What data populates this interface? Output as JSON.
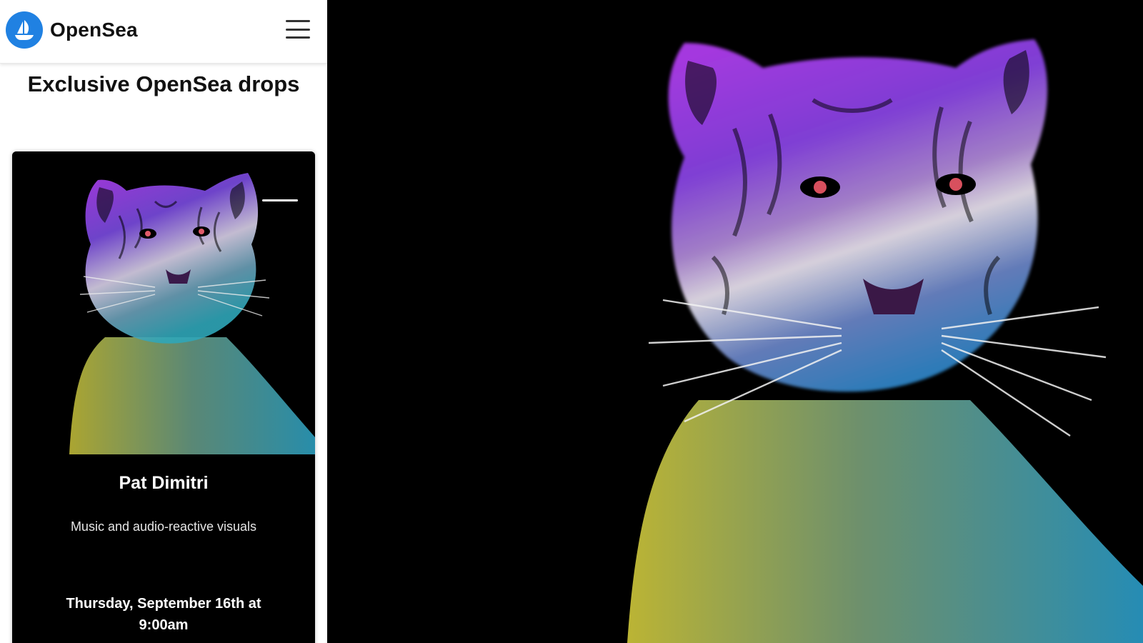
{
  "header": {
    "brand": "OpenSea",
    "logo_icon": "sailboat-icon",
    "menu_icon": "hamburger-menu-icon"
  },
  "section": {
    "title": "Exclusive OpenSea drops"
  },
  "drop": {
    "artist": "Pat Dimitri",
    "description": "Music and audio-reactive visuals",
    "date": "Thursday, September 16th at 9:00am",
    "artwork_icon": "neon-tiger-artwork"
  },
  "colors": {
    "brand_blue": "#2081e2",
    "card_bg": "#000000",
    "tiger_purple": "#a63cf0",
    "tiger_pink": "#e05ab0",
    "tiger_yellow": "#c9c23a",
    "tiger_teal": "#2fa6b8"
  }
}
